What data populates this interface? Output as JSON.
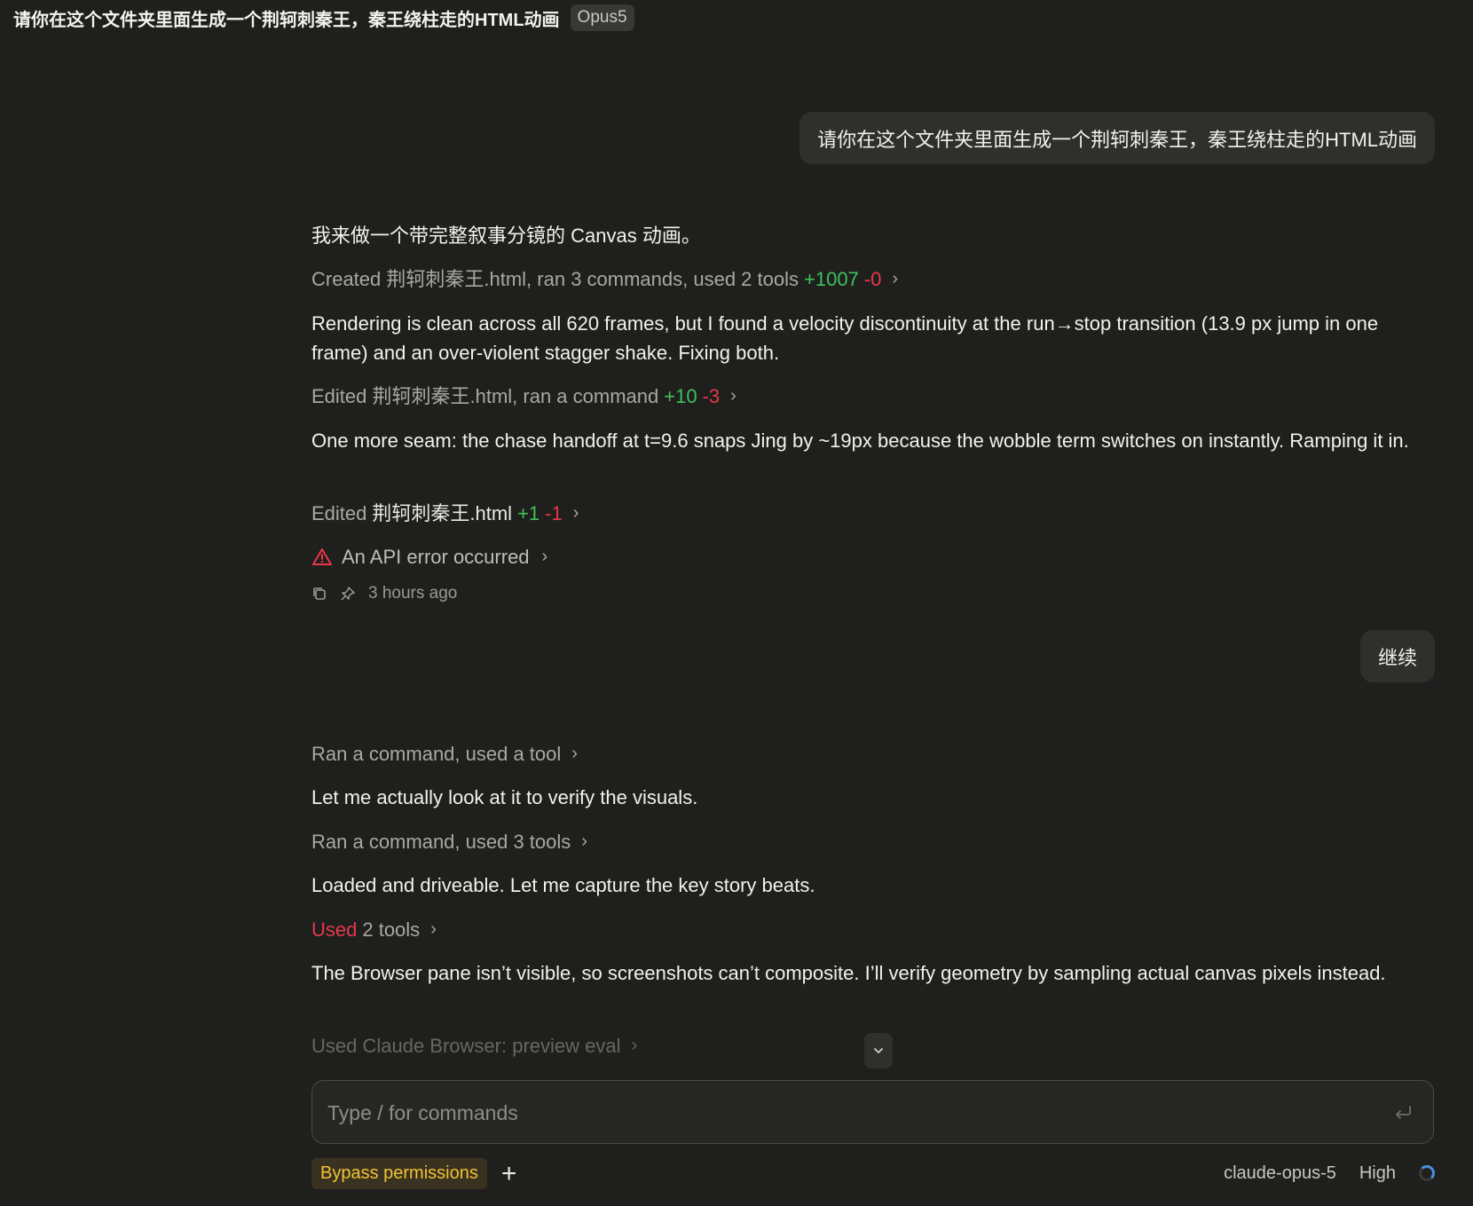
{
  "header": {
    "title": "请你在这个文件夹里面生成一个荆轲刺秦王，秦王绕柱走的HTML动画",
    "model_badge": "Opus5"
  },
  "messages": {
    "user_1": "请你在这个文件夹里面生成一个荆轲刺秦王，秦王绕柱走的HTML动画",
    "intro": "我来做一个带完整叙事分镜的 Canvas 动画。",
    "tool_1": {
      "label": "Created 荆轲刺秦王.html, ran 3 commands, used 2 tools",
      "added": "+1007",
      "removed": "-0"
    },
    "text_1": "Rendering is clean across all 620 frames, but I found a velocity discontinuity at the run→stop transition (13.9 px jump in one frame) and an over-violent stagger shake. Fixing both.",
    "tool_2": {
      "label": "Edited 荆轲刺秦王.html, ran a command",
      "added": "+10",
      "removed": "-3"
    },
    "text_2": "One more seam: the chase handoff at t=9.6 snaps Jing by ~19px because the wobble term switches on instantly. Ramping it in.",
    "tool_3": {
      "prefix": "Edited",
      "file": "荆轲刺秦王.html",
      "added": "+1",
      "removed": "-1"
    },
    "error": "An API error occurred",
    "timestamp": "3 hours ago",
    "user_2": "继续",
    "tool_4": "Ran a command, used a tool",
    "text_3": "Let me actually look at it to verify the visuals.",
    "tool_5": "Ran a command, used 3 tools",
    "text_4": "Loaded and driveable. Let me capture the key story beats.",
    "tool_6": {
      "prefix": "Used",
      "rest": "2 tools"
    },
    "text_5": "The Browser pane isn’t visible, so screenshots can’t composite. I’ll verify geometry by sampling actual canvas pixels instead.",
    "tool_7": "Used Claude Browser: preview eval"
  },
  "input": {
    "placeholder": "Type / for commands"
  },
  "footer": {
    "bypass_label": "Bypass permissions",
    "model": "claude-opus-5",
    "effort": "High"
  },
  "colors": {
    "background": "#1f1f1e",
    "added": "#3fc25a",
    "removed": "#e5394a",
    "bypass": "#f0c233",
    "spinner": "#4a8fe0"
  }
}
